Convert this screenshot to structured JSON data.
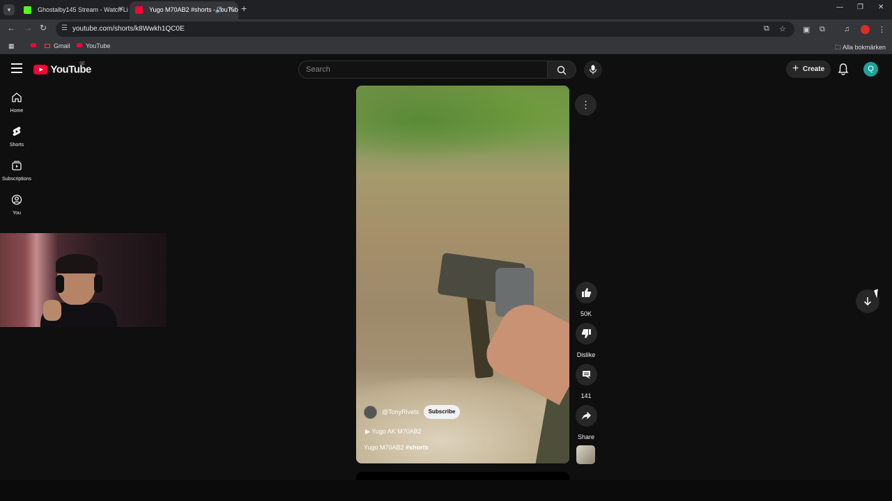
{
  "browser": {
    "tabs": [
      {
        "title": "Ghostalby145 Stream - Watch Li",
        "active": false
      },
      {
        "title": "Yugo M70AB2 #shorts - YouTube",
        "active": true
      }
    ],
    "url": "youtube.com/shorts/k8Wwkh1QC0E",
    "bookmarks": [
      "Gmail",
      "YouTube"
    ],
    "all_bookmarks_label": "Alla bokmärken"
  },
  "youtube": {
    "logo_text": "YouTube",
    "country_code": "SE",
    "search_placeholder": "Search",
    "create_label": "Create",
    "avatar_letter": "Q",
    "guide": [
      {
        "label": "Home",
        "icon": "home-icon"
      },
      {
        "label": "Shorts",
        "icon": "shorts-icon"
      },
      {
        "label": "Subscriptions",
        "icon": "subscriptions-icon"
      },
      {
        "label": "You",
        "icon": "you-icon"
      }
    ]
  },
  "short": {
    "channel": "@TonyRivets",
    "subscribe_label": "Subscribe",
    "sound": "Yugo AK M70AB2",
    "title_prefix": "Yugo M70AB2",
    "hashtag": "#shorts",
    "likes": "50K",
    "dislike_label": "Dislike",
    "comments": "141",
    "share_label": "Share"
  },
  "colors": {
    "background": "#0f0f0f",
    "brand_red": "#ff0033",
    "button_bg": "#272727",
    "avatar": "#1aa39a"
  }
}
